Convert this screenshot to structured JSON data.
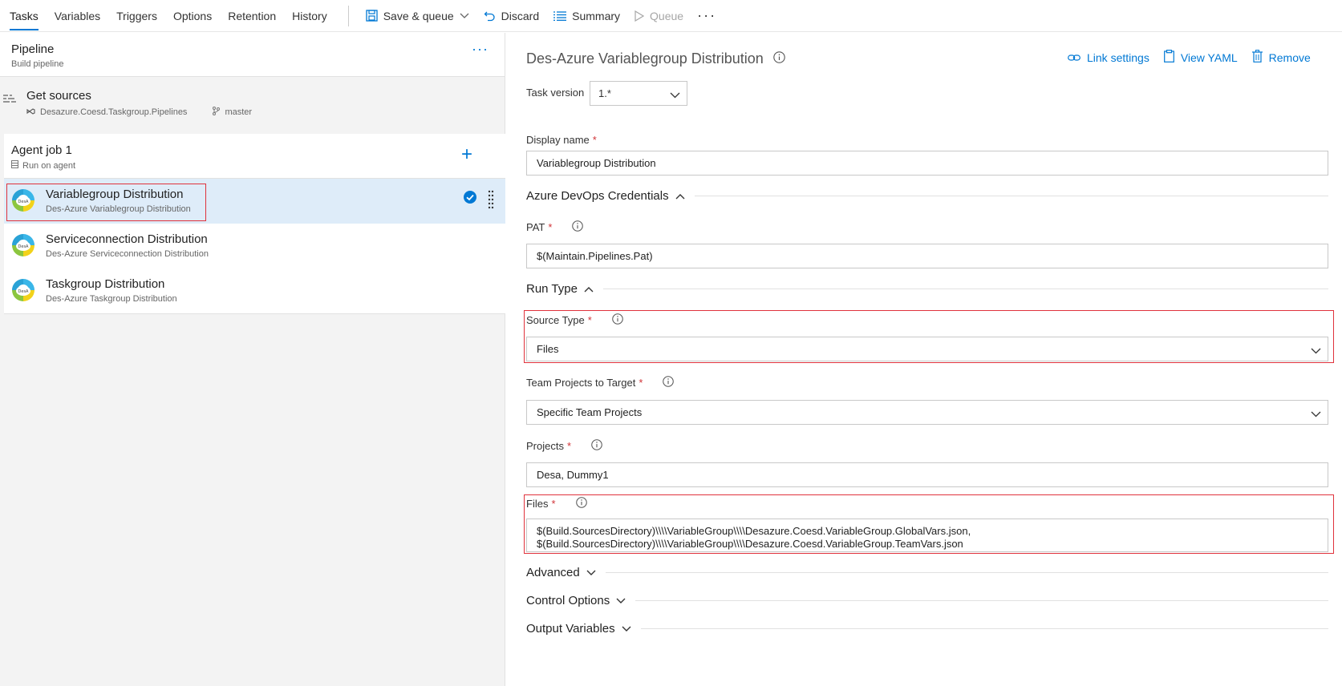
{
  "toolbar": {
    "tabs": [
      "Tasks",
      "Variables",
      "Triggers",
      "Options",
      "Retention",
      "History"
    ],
    "save_queue": "Save & queue",
    "discard": "Discard",
    "summary": "Summary",
    "queue": "Queue",
    "more": "···"
  },
  "pipeline": {
    "title": "Pipeline",
    "subtitle": "Build pipeline",
    "more": "···",
    "get_sources": {
      "title": "Get sources",
      "repo": "Desazure.Coesd.Taskgroup.Pipelines",
      "branch": "master"
    },
    "agent_job": {
      "title": "Agent job 1",
      "subtitle": "Run on agent",
      "add": "+"
    },
    "tasks": [
      {
        "title": "Variablegroup Distribution",
        "subtitle": "Des-Azure Variablegroup Distribution",
        "selected": true
      },
      {
        "title": "Serviceconnection Distribution",
        "subtitle": "Des-Azure Serviceconnection Distribution"
      },
      {
        "title": "Taskgroup Distribution",
        "subtitle": "Des-Azure Taskgroup Distribution"
      }
    ]
  },
  "details": {
    "title": "Des-Azure Variablegroup Distribution",
    "actions": {
      "link_settings": "Link settings",
      "view_yaml": "View YAML",
      "remove": "Remove"
    },
    "task_version_label": "Task version",
    "task_version_value": "1.*",
    "display_name_label": "Display name",
    "display_name_value": "Variablegroup Distribution",
    "sections": {
      "credentials": "Azure DevOps Credentials",
      "run_type": "Run Type",
      "advanced": "Advanced",
      "control_options": "Control Options",
      "output_variables": "Output Variables"
    },
    "pat_label": "PAT",
    "pat_value": "$(Maintain.Pipelines.Pat)",
    "source_type_label": "Source Type",
    "source_type_value": "Files",
    "team_projects_label": "Team Projects to Target",
    "team_projects_value": "Specific Team Projects",
    "projects_label": "Projects",
    "projects_value": "Desa, Dummy1",
    "files_label": "Files",
    "files_line1": "$(Build.SourcesDirectory)\\\\\\\\VariableGroup\\\\\\\\Desazure.Coesd.VariableGroup.GlobalVars.json,",
    "files_line2": "$(Build.SourcesDirectory)\\\\\\\\VariableGroup\\\\\\\\Desazure.Coesd.VariableGroup.TeamVars.json",
    "required_mark": "*"
  },
  "colors": {
    "accent": "#0078d4",
    "selected_row": "#deecf9",
    "highlight": "#e0323c",
    "required": "#d13438"
  }
}
